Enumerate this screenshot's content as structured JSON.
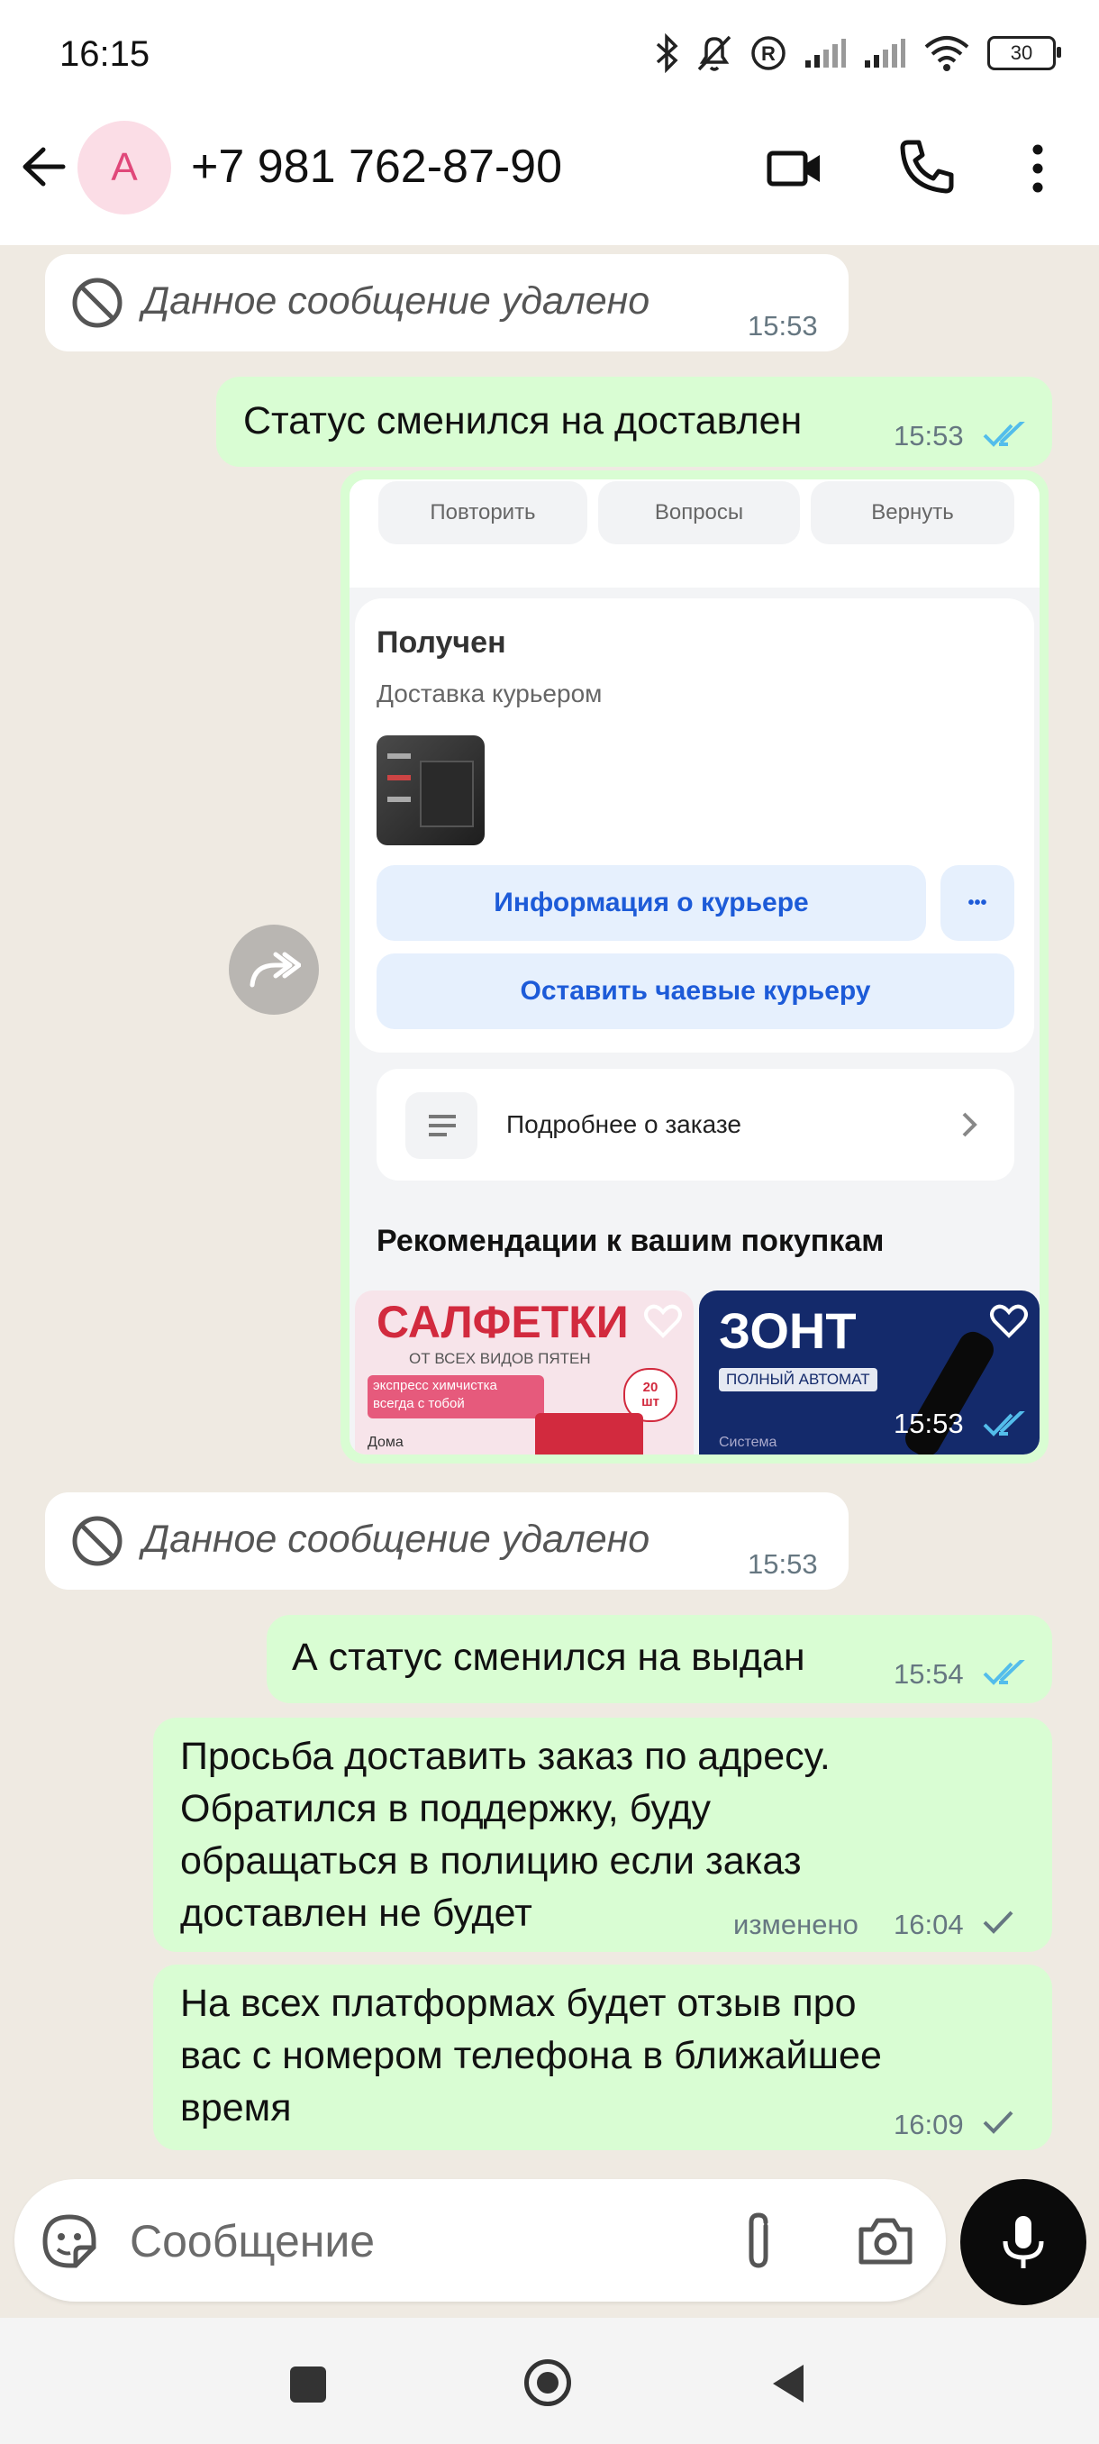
{
  "status_bar": {
    "time": "16:15",
    "battery": "30"
  },
  "header": {
    "avatar_letter": "А",
    "contact": "+7 981 762-87-90"
  },
  "messages": {
    "deleted_1": {
      "text": "Данное сообщение удалено",
      "time": "15:53"
    },
    "out_1": {
      "text": "Статус сменился на доставлен",
      "time": "15:53"
    },
    "image": {
      "time": "15:53",
      "top_buttons": [
        "Повторить",
        "Вопросы",
        "Вернуть"
      ],
      "status_title": "Получен",
      "delivery_type": "Доставка курьером",
      "courier_info": "Информация о курьере",
      "more_dots": "•••",
      "tip_courier": "Оставить чаевые курьеру",
      "order_details": "Подробнее о заказе",
      "recommendations": "Рекомендации к вашим покупкам",
      "product_1": {
        "title": "САЛФЕТКИ",
        "subtitle": "ОТ ВСЕХ ВИДОВ ПЯТЕН",
        "promo": "экспресс химчистка всегда с тобой",
        "badge": "20 шт",
        "brand": "Дома"
      },
      "product_2": {
        "title": "ЗОНТ",
        "subtitle": "ПОЛНЫЙ АВТОМАТ",
        "brand": "Система"
      }
    },
    "deleted_2": {
      "text": "Данное сообщение удалено",
      "time": "15:53"
    },
    "out_2": {
      "text": "А статус сменился на выдан",
      "time": "15:54"
    },
    "out_3": {
      "lines": [
        "Просьба доставить заказ по адресу.",
        "Обратился в поддержку, буду",
        "обращаться в полицию если заказ",
        "доставлен не будет"
      ],
      "edited": "изменено",
      "time": "16:04"
    },
    "out_4": {
      "lines": [
        "На всех платформах будет отзыв про",
        "вас с номером телефона в ближайшее",
        "время"
      ],
      "time": "16:09"
    }
  },
  "input": {
    "placeholder": "Сообщение"
  },
  "colors": {
    "outgoing": "#d9fdd3",
    "incoming": "#ffffff",
    "chat_bg": "#efeae2",
    "read_ticks": "#53bdeb",
    "link_blue": "#1d5bd8"
  }
}
